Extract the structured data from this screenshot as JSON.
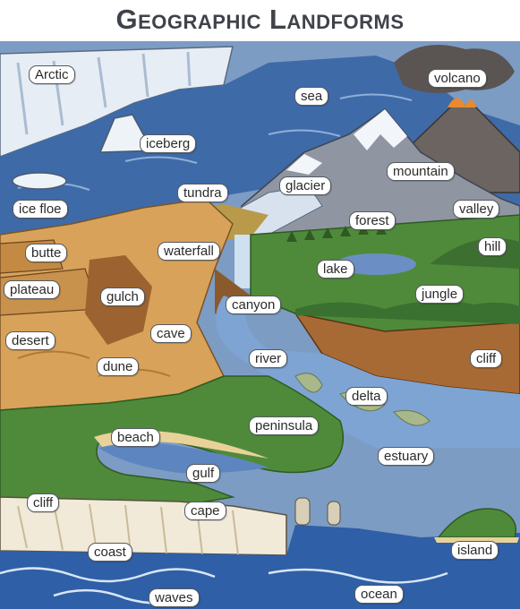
{
  "title": "Geographic Landforms",
  "labels": {
    "arctic": "Arctic",
    "sea": "sea",
    "volcano": "volcano",
    "iceberg": "iceberg",
    "ice_floe": "ice floe",
    "tundra": "tundra",
    "glacier": "glacier",
    "mountain": "mountain",
    "forest": "forest",
    "valley": "valley",
    "butte": "butte",
    "waterfall": "waterfall",
    "hill": "hill",
    "lake": "lake",
    "plateau": "plateau",
    "gulch": "gulch",
    "canyon": "canyon",
    "jungle": "jungle",
    "cave": "cave",
    "desert": "desert",
    "river": "river",
    "cliff_right": "cliff",
    "dune": "dune",
    "delta": "delta",
    "peninsula": "peninsula",
    "beach": "beach",
    "estuary": "estuary",
    "gulf": "gulf",
    "cliff_left": "cliff",
    "cape": "cape",
    "island": "island",
    "coast": "coast",
    "waves": "waves",
    "ocean": "ocean"
  },
  "colors": {
    "title": "#3f4249",
    "sky": "#6f8fb8",
    "sea": "#3f68a8",
    "ocean": "#2f5fa6",
    "ice": "#e8eef5",
    "desert": "#d9a25a",
    "grass": "#4f8a3a",
    "forest": "#3d6e2c",
    "cliff": "#a86a34",
    "mountain": "#8a8f99",
    "lava": "#e07a2a"
  }
}
